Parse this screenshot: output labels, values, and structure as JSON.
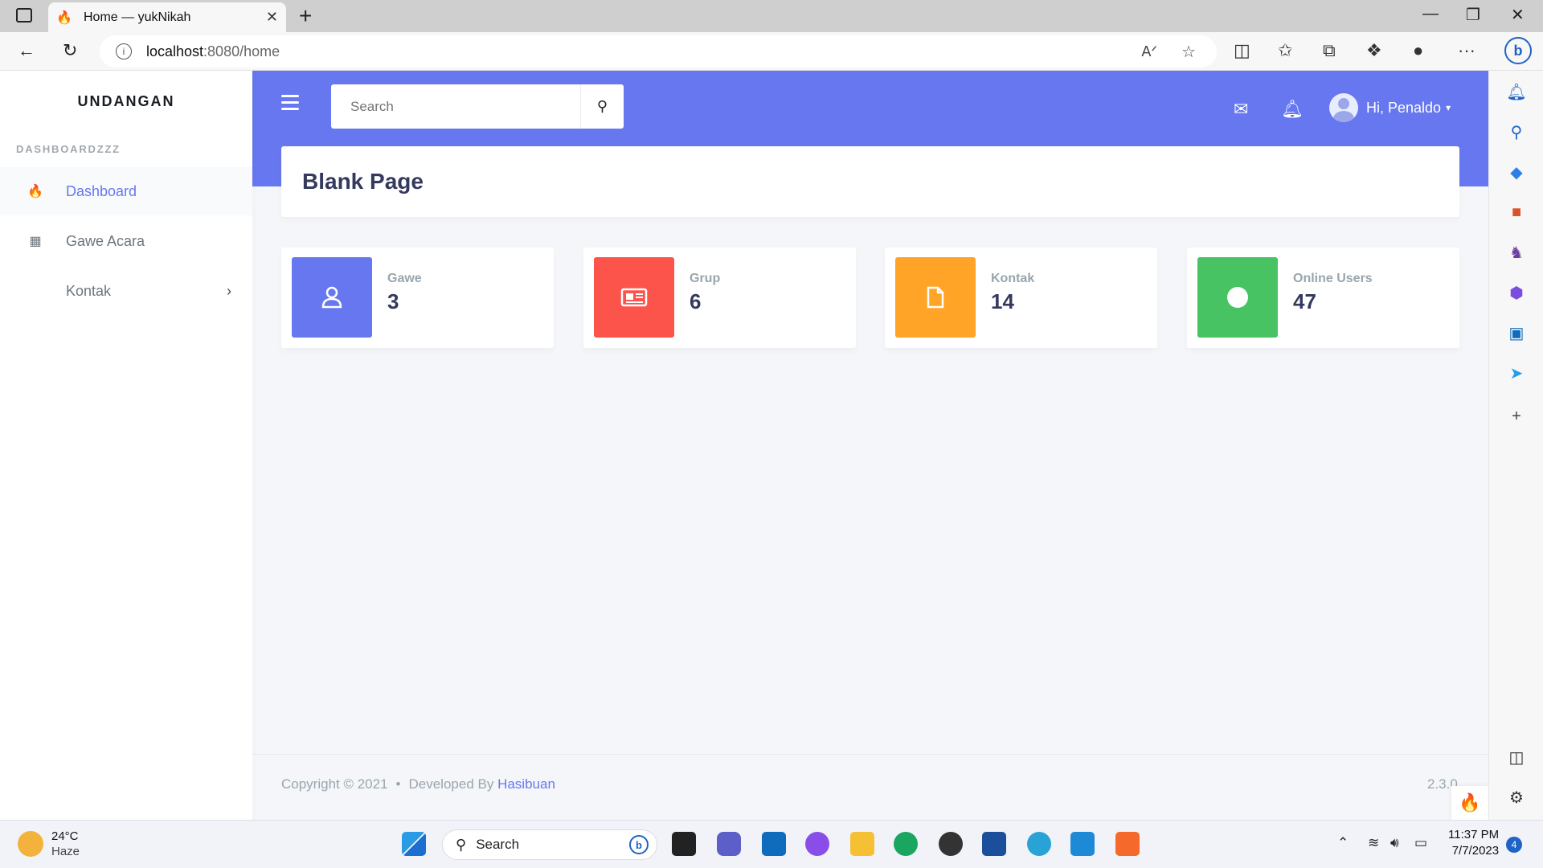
{
  "browser": {
    "tab_title": "Home — yukNikah",
    "url_host": "localhost",
    "url_path": ":8080/home"
  },
  "app": {
    "brand": "UNDANGAN",
    "menu_header": "DASHBOARDZZZ",
    "menu": [
      {
        "label": "Dashboard",
        "active": true,
        "icon": "fire-icon"
      },
      {
        "label": "Gawe Acara",
        "active": false,
        "icon": "calendar-icon"
      },
      {
        "label": "Kontak",
        "active": false,
        "icon": "chevron-right-icon"
      }
    ],
    "search_placeholder": "Search",
    "user_greeting": "Hi, Penaldo",
    "page_title": "Blank Page",
    "cards": [
      {
        "label": "Gawe",
        "value": "3",
        "color": "#6777ef",
        "icon": "user-icon"
      },
      {
        "label": "Grup",
        "value": "6",
        "color": "#fc544b",
        "icon": "newspaper-icon"
      },
      {
        "label": "Kontak",
        "value": "14",
        "color": "#ffa426",
        "icon": "file-icon"
      },
      {
        "label": "Online Users",
        "value": "47",
        "color": "#47c363",
        "icon": "circle-icon"
      }
    ],
    "footer": {
      "copyright": "Copyright © 2021",
      "developed_by": "Developed By",
      "author": "Hasibuan",
      "version": "2.3.0"
    }
  },
  "taskbar": {
    "temp": "24°C",
    "weather": "Haze",
    "search": "Search",
    "time": "11:37 PM",
    "date": "7/7/2023",
    "notifications": "4"
  }
}
